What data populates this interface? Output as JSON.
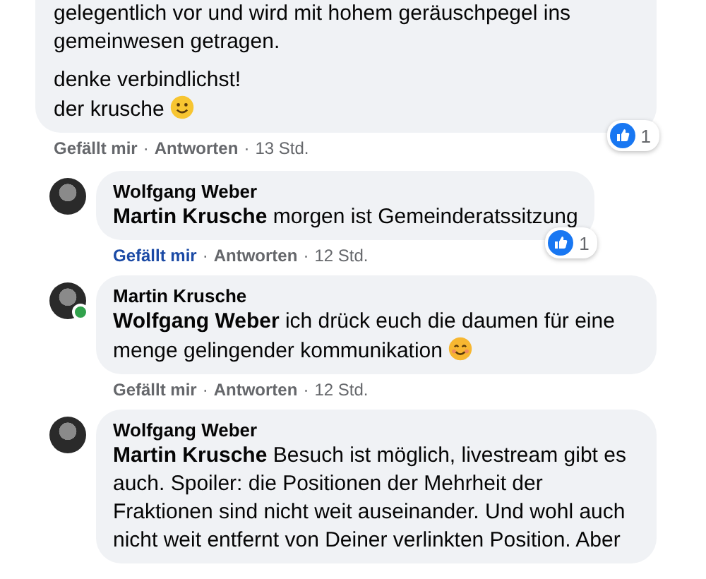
{
  "comments": [
    {
      "text": "gelegentlich vor und wird mit hohem geräuschpegel ins gemeinwesen getragen.",
      "closing": "denke verbindlichst!\nder krusche",
      "emoji": {
        "kind": "smile"
      },
      "actions": {
        "like": "Gefällt mir",
        "liked": false,
        "sep_1": "·",
        "reply": "Antworten",
        "sep_2": "·",
        "time": "13 Std."
      },
      "reactions": "1",
      "nested": false
    },
    {
      "author": "Wolfgang Weber",
      "mention": "Martin Krusche",
      "text": "morgen ist Gemeinderatssitzung",
      "actions": {
        "like": "Gefällt mir",
        "liked": true,
        "sep_1": "·",
        "reply": "Antworten",
        "sep_2": "·",
        "time": "12 Std."
      },
      "reactions": "1",
      "online": false,
      "nested": true
    },
    {
      "author": "Martin Krusche",
      "mention": "Wolfgang Weber",
      "text": "ich drück euch die daumen für eine menge gelingender kommunikation",
      "emoji": {
        "kind": "blush"
      },
      "actions": {
        "like": "Gefällt mir",
        "liked": false,
        "sep_1": "·",
        "reply": "Antworten",
        "sep_2": "·",
        "time": "12 Std."
      },
      "online": true,
      "nested": true
    },
    {
      "author": "Wolfgang Weber",
      "mention": "Martin Krusche",
      "text": "Besuch ist möglich, livestream gibt es auch. Spoiler: die Positionen der Mehrheit der Fraktionen sind nicht weit auseinander. Und wohl auch nicht weit entfernt von Deiner verlinkten Position. Aber",
      "online": false,
      "nested": true
    }
  ]
}
